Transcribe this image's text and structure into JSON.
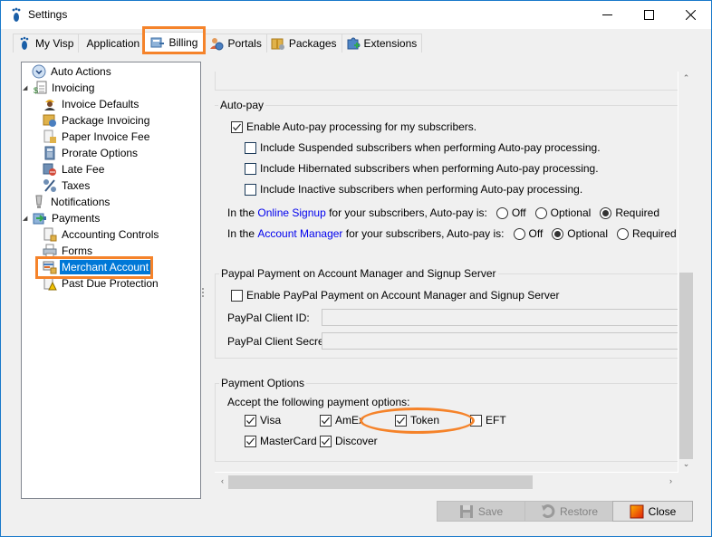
{
  "window": {
    "title": "Settings",
    "controls": {
      "minimize": "—",
      "maximize": "☐",
      "close": "✕"
    }
  },
  "tabs": [
    {
      "label": "My Visp",
      "icon": "footprint-icon",
      "active": false
    },
    {
      "label": "Application",
      "icon": "application-settings-icon",
      "active": false
    },
    {
      "label": "Billing",
      "icon": "billing-icon",
      "active": true
    },
    {
      "label": "Portals",
      "icon": "portals-icon",
      "active": false
    },
    {
      "label": "Packages",
      "icon": "packages-icon",
      "active": false
    },
    {
      "label": "Extensions",
      "icon": "extensions-icon",
      "active": false
    }
  ],
  "tree": [
    {
      "label": "Auto Actions",
      "icon": "clock-icon",
      "level": 0,
      "expander": ""
    },
    {
      "label": "Invoicing",
      "icon": "invoice-icon",
      "level": 0,
      "expander": "◢"
    },
    {
      "label": "Invoice Defaults",
      "icon": "worker-icon",
      "level": 1,
      "expander": ""
    },
    {
      "label": "Package Invoicing",
      "icon": "package-invoice-icon",
      "level": 1,
      "expander": ""
    },
    {
      "label": "Paper Invoice Fee",
      "icon": "paper-invoice-icon",
      "level": 1,
      "expander": ""
    },
    {
      "label": "Prorate Options",
      "icon": "calculator-icon",
      "level": 1,
      "expander": ""
    },
    {
      "label": "Late Fee",
      "icon": "late-fee-icon",
      "level": 1,
      "expander": ""
    },
    {
      "label": "Taxes",
      "icon": "percent-icon",
      "level": 1,
      "expander": ""
    },
    {
      "label": "Notifications",
      "icon": "notification-icon",
      "level": 0,
      "expander": ""
    },
    {
      "label": "Payments",
      "icon": "payments-icon",
      "level": 0,
      "expander": "◢"
    },
    {
      "label": "Accounting Controls",
      "icon": "locked-document-icon",
      "level": 1,
      "expander": ""
    },
    {
      "label": "Forms",
      "icon": "printer-icon",
      "level": 1,
      "expander": ""
    },
    {
      "label": "Merchant Account",
      "icon": "merchant-lock-icon",
      "level": 1,
      "expander": "",
      "selected": true
    },
    {
      "label": "Past Due Protection",
      "icon": "warning-document-icon",
      "level": 1,
      "expander": ""
    }
  ],
  "autopay": {
    "title": "Auto-pay",
    "enable": {
      "label": "Enable Auto-pay processing for my subscribers.",
      "checked": true
    },
    "include": [
      {
        "label": "Include Suspended subscribers when performing Auto-pay processing.",
        "checked": false
      },
      {
        "label": "Include Hibernated subscribers when performing Auto-pay processing.",
        "checked": false
      },
      {
        "label": "Include Inactive subscribers when performing Auto-pay processing.",
        "checked": false
      }
    ],
    "online_signup": {
      "prefix": "In the ",
      "link": "Online Signup",
      "suffix": " for your subscribers, Auto-pay is:",
      "options": [
        "Off",
        "Optional",
        "Required"
      ],
      "selected": "Required"
    },
    "account_manager": {
      "prefix": "In the ",
      "link": "Account Manager",
      "suffix": " for your subscribers, Auto-pay is:",
      "options": [
        "Off",
        "Optional",
        "Required"
      ],
      "selected": "Optional"
    }
  },
  "paypal": {
    "title": "Paypal Payment on Account Manager and Signup Server",
    "enable": {
      "label": "Enable PayPal Payment on Account Manager and Signup Server",
      "checked": false
    },
    "client_id_label": "PayPal Client ID:",
    "client_id_value": "",
    "client_secret_label": "PayPal Client Secret:",
    "client_secret_value": ""
  },
  "payment_options": {
    "title": "Payment Options",
    "prompt": "Accept the following payment options:",
    "options": [
      {
        "label": "Visa",
        "checked": true
      },
      {
        "label": "AmEx",
        "checked": true
      },
      {
        "label": "Token",
        "checked": true
      },
      {
        "label": "EFT",
        "checked": false
      },
      {
        "label": "MasterCard",
        "checked": true
      },
      {
        "label": "Discover",
        "checked": true
      }
    ]
  },
  "scroll": {
    "vertical_arrow_up": "⌃",
    "vertical_arrow_down": "⌄",
    "horizontal_arrow_left": "‹",
    "horizontal_arrow_right": "›"
  },
  "buttons": {
    "save": {
      "label": "Save",
      "enabled": false
    },
    "restore": {
      "label": "Restore",
      "enabled": false
    },
    "close": {
      "label": "Close",
      "enabled": true
    }
  },
  "colors": {
    "highlight": "#f5832a",
    "selection": "#0078d7",
    "link": "#0000ee",
    "window_border": "#1979ca"
  }
}
